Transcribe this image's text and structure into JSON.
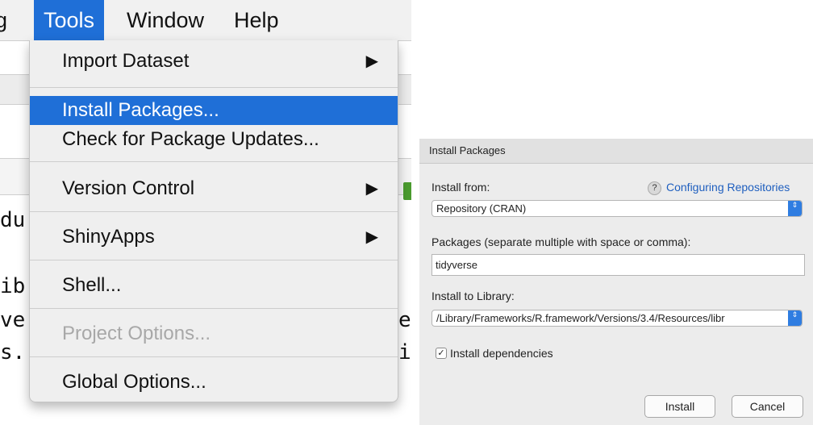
{
  "menubar": {
    "partial_item": "g",
    "items": [
      "Tools",
      "Window",
      "Help"
    ],
    "active": "Tools"
  },
  "tools_menu": {
    "items": [
      {
        "label": "Import Dataset",
        "submenu": true
      },
      {
        "label": "Install Packages...",
        "selected": true
      },
      {
        "label": "Check for Package Updates..."
      },
      {
        "label": "Version Control",
        "submenu": true
      },
      {
        "label": "ShinyApps",
        "submenu": true
      },
      {
        "label": "Shell..."
      },
      {
        "label": "Project Options...",
        "disabled": true
      },
      {
        "label": "Global Options..."
      }
    ],
    "submenu_glyph": "▶"
  },
  "background_text": {
    "fragments_left": [
      "du",
      "ib",
      "ve",
      "s."
    ],
    "fragments_right": [
      "e",
      "i"
    ]
  },
  "dialog": {
    "title": "Install Packages",
    "install_from_label": "Install from:",
    "help_icon": "?",
    "help_link": "Configuring Repositories",
    "install_from_value": "Repository (CRAN)",
    "packages_label": "Packages (separate multiple with space or comma):",
    "packages_value": "tidyverse",
    "library_label": "Install to Library:",
    "library_value": "/Library/Frameworks/R.framework/Versions/3.4/Resources/libr",
    "dependencies_label": "Install dependencies",
    "dependencies_checked": true,
    "check_glyph": "✓",
    "stepper_glyph": "⇕",
    "install_button": "Install",
    "cancel_button": "Cancel",
    "accent_color": "#2f7de1"
  }
}
